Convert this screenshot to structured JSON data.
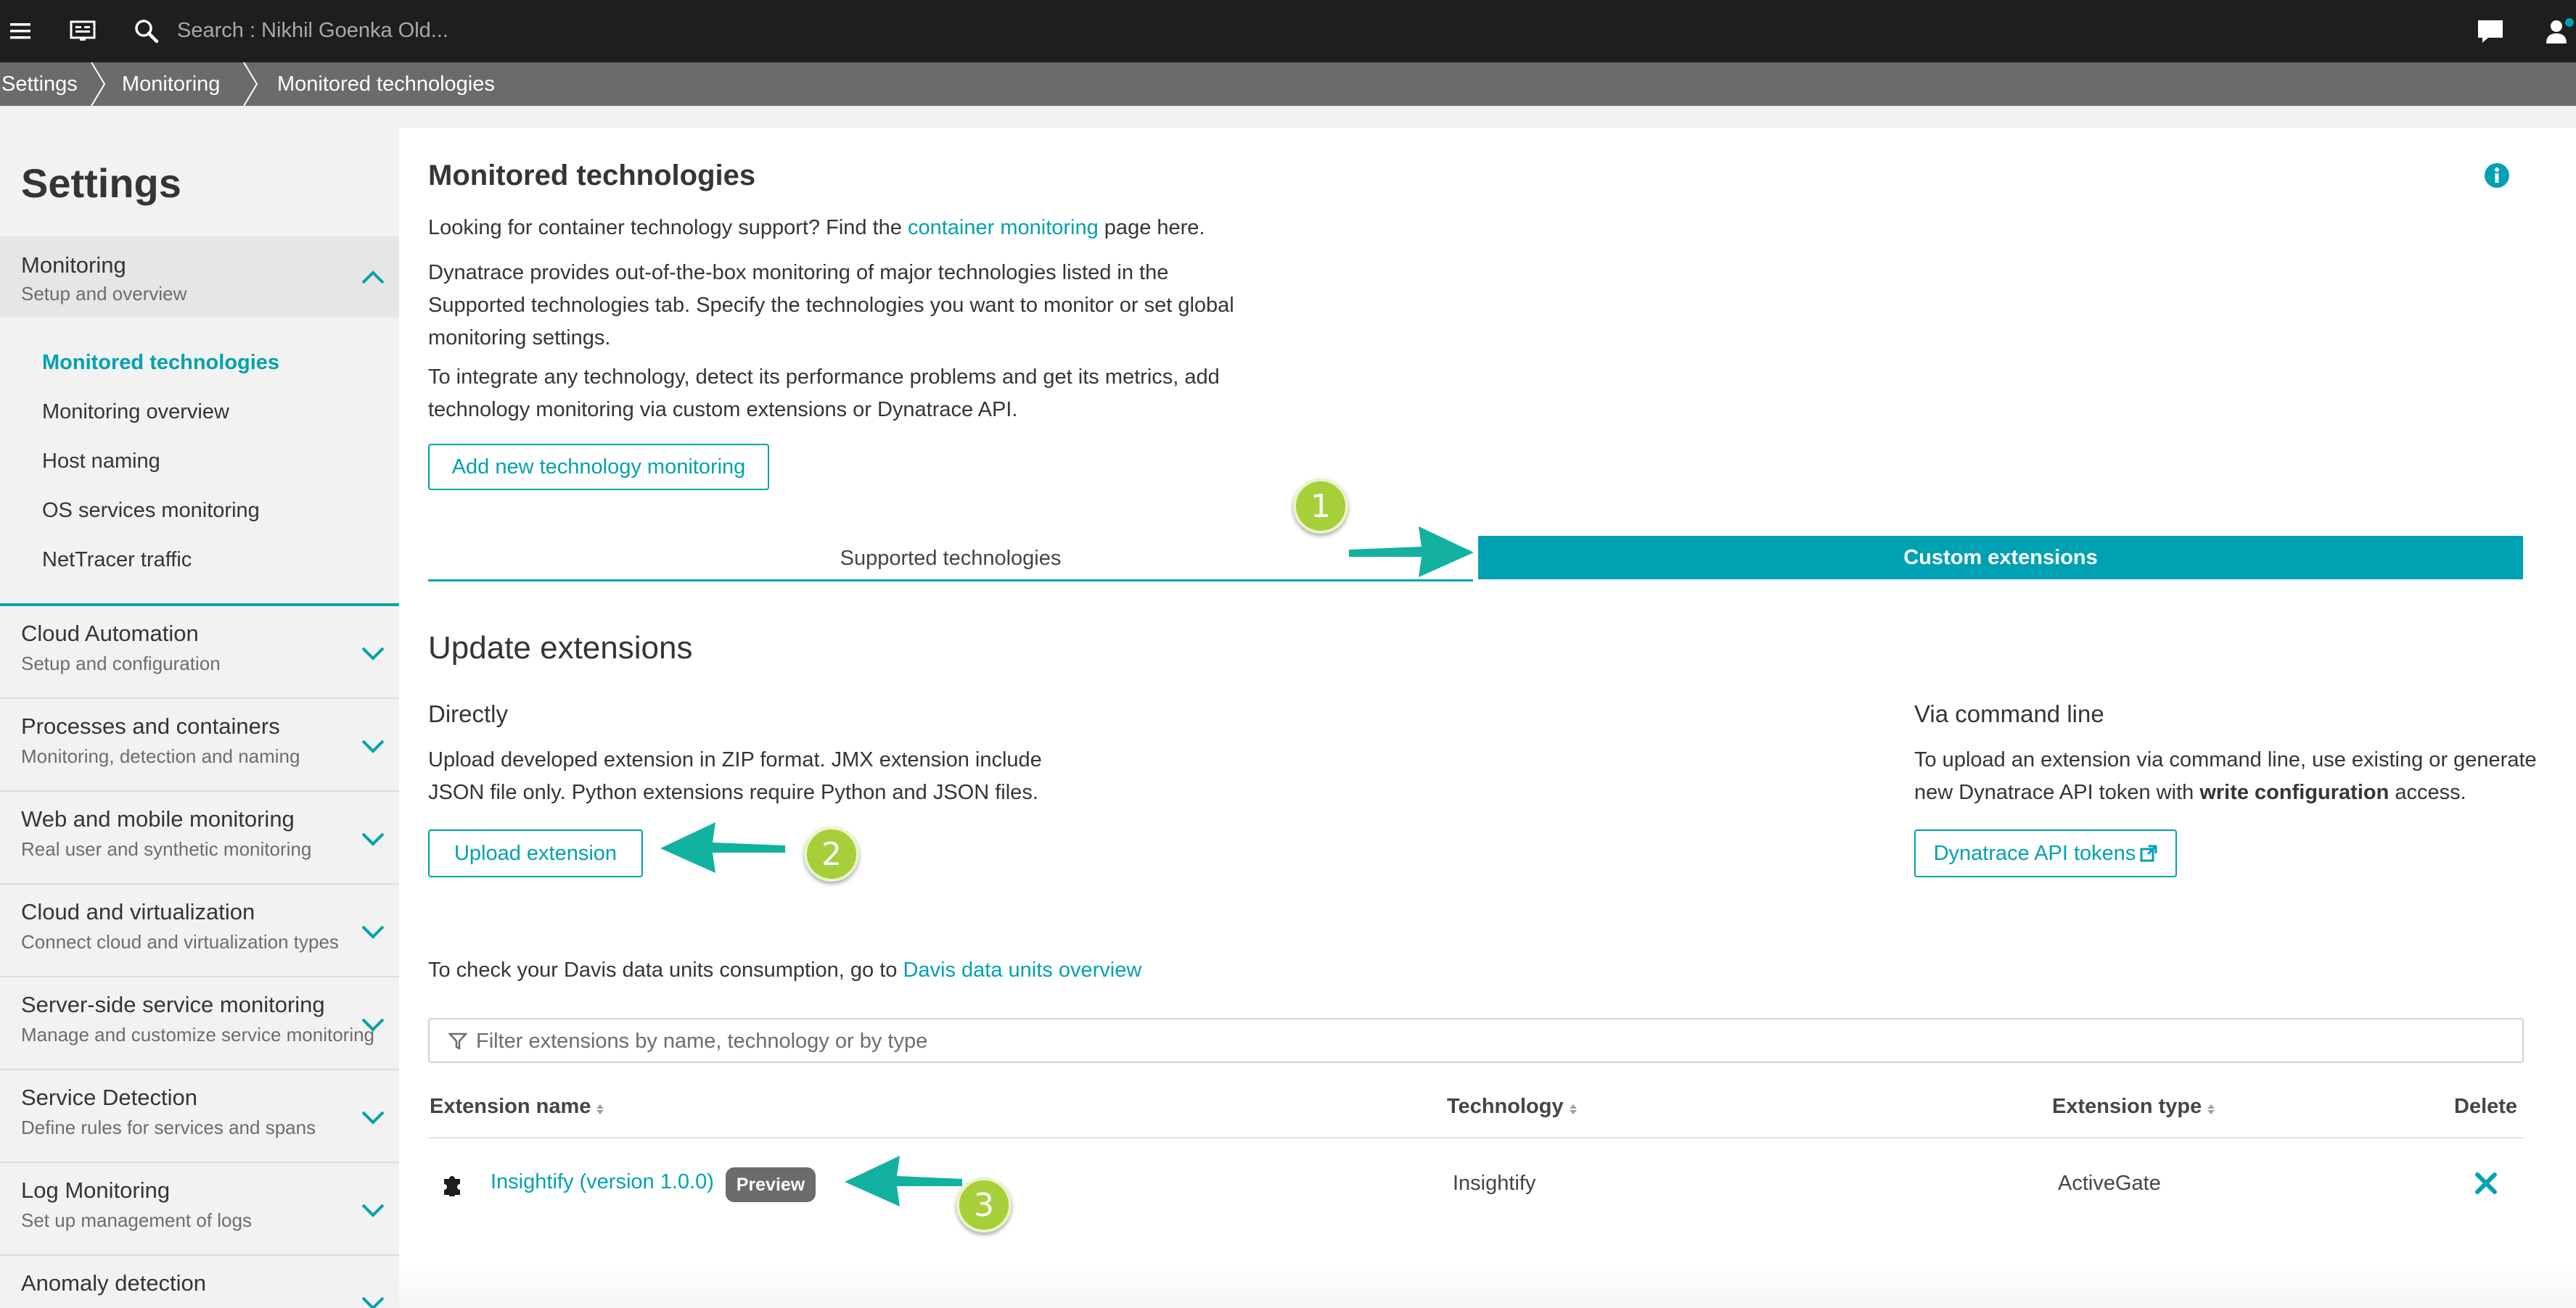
{
  "topbar": {
    "search_placeholder": "Search : Nikhil Goenka Old..."
  },
  "breadcrumb": [
    "Settings",
    "Monitoring",
    "Monitored technologies"
  ],
  "sidebar": {
    "title": "Settings",
    "monitoring": {
      "title": "Monitoring",
      "subtitle": "Setup and overview",
      "items": [
        "Monitored technologies",
        "Monitoring overview",
        "Host naming",
        "OS services monitoring",
        "NetTracer traffic"
      ]
    },
    "groups": [
      {
        "title": "Cloud Automation",
        "subtitle": "Setup and configuration"
      },
      {
        "title": "Processes and containers",
        "subtitle": "Monitoring, detection and naming"
      },
      {
        "title": "Web and mobile monitoring",
        "subtitle": "Real user and synthetic monitoring"
      },
      {
        "title": "Cloud and virtualization",
        "subtitle": "Connect cloud and virtualization types"
      },
      {
        "title": "Server-side service monitoring",
        "subtitle": "Manage and customize service monitoring"
      },
      {
        "title": "Service Detection",
        "subtitle": "Define rules for services and spans"
      },
      {
        "title": "Log Monitoring",
        "subtitle": "Set up management of logs"
      },
      {
        "title": "Anomaly detection",
        "subtitle": ""
      }
    ]
  },
  "main": {
    "title": "Monitored technologies",
    "container_pre": "Looking for container technology support? Find the ",
    "container_link": "container monitoring",
    "container_post": " page here.",
    "desc1_line1": "Dynatrace provides out-of-the-box monitoring of major technologies listed in the",
    "desc1_line2": "Supported technologies tab. Specify the technologies you want to monitor or set global",
    "desc1_line3": "monitoring settings.",
    "desc2_line1": "To integrate any technology, detect its performance problems and get its metrics, add",
    "desc2_line2": "technology monitoring via custom extensions or Dynatrace API.",
    "add_button": "Add new technology monitoring",
    "tabs": {
      "supported": "Supported technologies",
      "custom": "Custom extensions"
    },
    "update_heading": "Update extensions",
    "directly": {
      "heading": "Directly",
      "line1": "Upload developed extension in ZIP format. JMX extension include",
      "line2": "JSON file only. Python extensions require Python and JSON files.",
      "button": "Upload extension"
    },
    "cli": {
      "heading": "Via command line",
      "line1": "To upload an extension via command line, use existing or generate",
      "line2_pre": "new Dynatrace API token with ",
      "line2_bold": "write configuration",
      "line2_post": " access.",
      "button": "Dynatrace API tokens"
    },
    "davis_pre": "To check your Davis data units consumption, go to ",
    "davis_link": "Davis data units overview",
    "filter_placeholder": "Filter extensions by name, technology or by type",
    "table": {
      "headers": [
        "Extension name",
        "Technology",
        "Extension type",
        "Delete"
      ],
      "rows": [
        {
          "name": "Insightify (version 1.0.0)",
          "badge": "Preview",
          "technology": "Insightify",
          "type": "ActiveGate"
        }
      ]
    }
  },
  "annotations": [
    "1",
    "2",
    "3"
  ],
  "colors": {
    "accent": "#00a1b2",
    "topbar": "#1e1e1e",
    "breadcrumb": "#6b6b6b",
    "callout": "#a6cf39",
    "arrow": "#13b1a0"
  }
}
